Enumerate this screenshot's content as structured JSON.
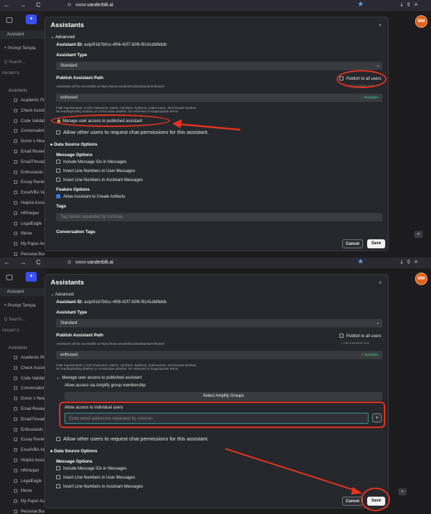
{
  "browser": {
    "url": "www.vanderbilt.ai",
    "url_domain": "vanderbilt.ai",
    "url_prefix": "www."
  },
  "avatar": "MM",
  "sidebar": {
    "assistant_tab": "Assistant",
    "prompt_templates": "+ Prompt Templa",
    "search_placeholder": "Q Search...",
    "prompts_header": "PROMPTS",
    "assistants_folder": "Assistants",
    "items": [
      "Academic Pla",
      "Check Assist",
      "Code Validat",
      "Conversation",
      "Donor x New",
      "Email Review",
      "EmailThread",
      "Enthusiastic",
      "Essay Review",
      "ExcelVBA Va",
      "Helpful Assis",
      "HRHelper",
      "LegalEagle",
      "Meow",
      "My Paper As",
      "Personal Bud"
    ]
  },
  "modal": {
    "title": "Assistants",
    "advanced": "Advanced",
    "assistant_id_label": "Assistant ID:",
    "assistant_id": "astp/91b7b0cc-4f08-42f7-92f6-f9141dbf8ddb",
    "assistant_type_label": "Assistant Type",
    "assistant_type_value": "Standard",
    "publish_path_label": "Publish Assistant Path",
    "publish_path_hint": "Assistants will be accessible at https://www.vanderbilt.ai/assistants/enthused",
    "publish_all_users": "Publish to all users",
    "add_assistant_icon": "+ Add Assistant Icon",
    "path_value": "enthused",
    "available": "✓ Available",
    "path_requirements_1": "Path requirements: 3-100 characters, letters, numbers, hyphens, underscores, and forward slashes.",
    "path_requirements_2": "No leading/trailing slashes or consecutive slashes. No reserved or inappropriate terms.",
    "manage_access": "Manage user access to published assistant",
    "allow_group": "Allow access via Amplify group membership",
    "select_groups": "Select Amplify Groups",
    "allow_individual": "Allow access to individual users",
    "email_placeholder": "Enter email addresses separated by commas",
    "chat_permissions": "Allow other users to request chat permissions for this assistant.",
    "data_source": "Data Source Options",
    "message_options": "Message Options",
    "include_ids": "Include Message IDs in Messages",
    "line_user": "Insert Line Numbers in User Messages",
    "line_assistant": "Insert Line Numbers in Assistant Messages",
    "feature_options": "Feature Options",
    "allow_artifacts": "Allow Assistant to Create Artifacts",
    "tags_label": "Tags",
    "tags_placeholder": "Tag names separated by commas.",
    "conversation_tags": "Conversation Tags",
    "cancel": "Cancel",
    "save": "Save",
    "close": "×"
  },
  "colors": {
    "accent": "#2f7ae5",
    "annotation": "#e5321f",
    "available": "#3ec47a"
  }
}
